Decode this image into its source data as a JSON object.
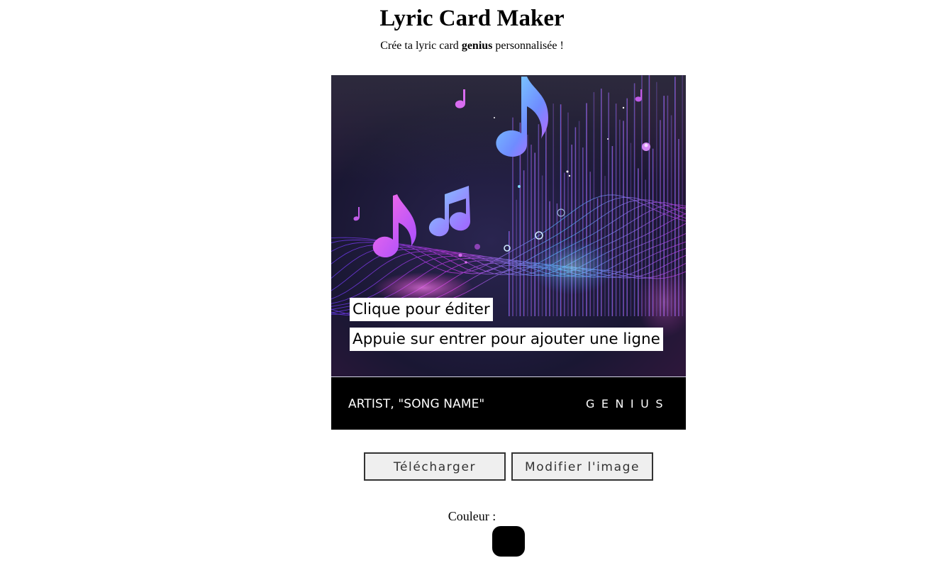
{
  "header": {
    "title": "Lyric Card Maker",
    "subtitle_before": "Crée ta lyric card ",
    "subtitle_bold": "genius",
    "subtitle_after": " personnalisée !"
  },
  "card": {
    "lyric_lines": [
      "Clique pour éditer",
      "Appuie sur entrer pour ajouter une ligne"
    ],
    "artist_song": "ARTIST, \"SONG NAME\"",
    "brand": "GENIUS",
    "footer_color": "#000000",
    "artwork_icons": [
      "music-note-icon",
      "waveform"
    ]
  },
  "actions": {
    "download_label": "Télécharger",
    "edit_image_label": "Modifier l'image"
  },
  "color_picker": {
    "label": "Couleur :",
    "value": "#000000"
  }
}
